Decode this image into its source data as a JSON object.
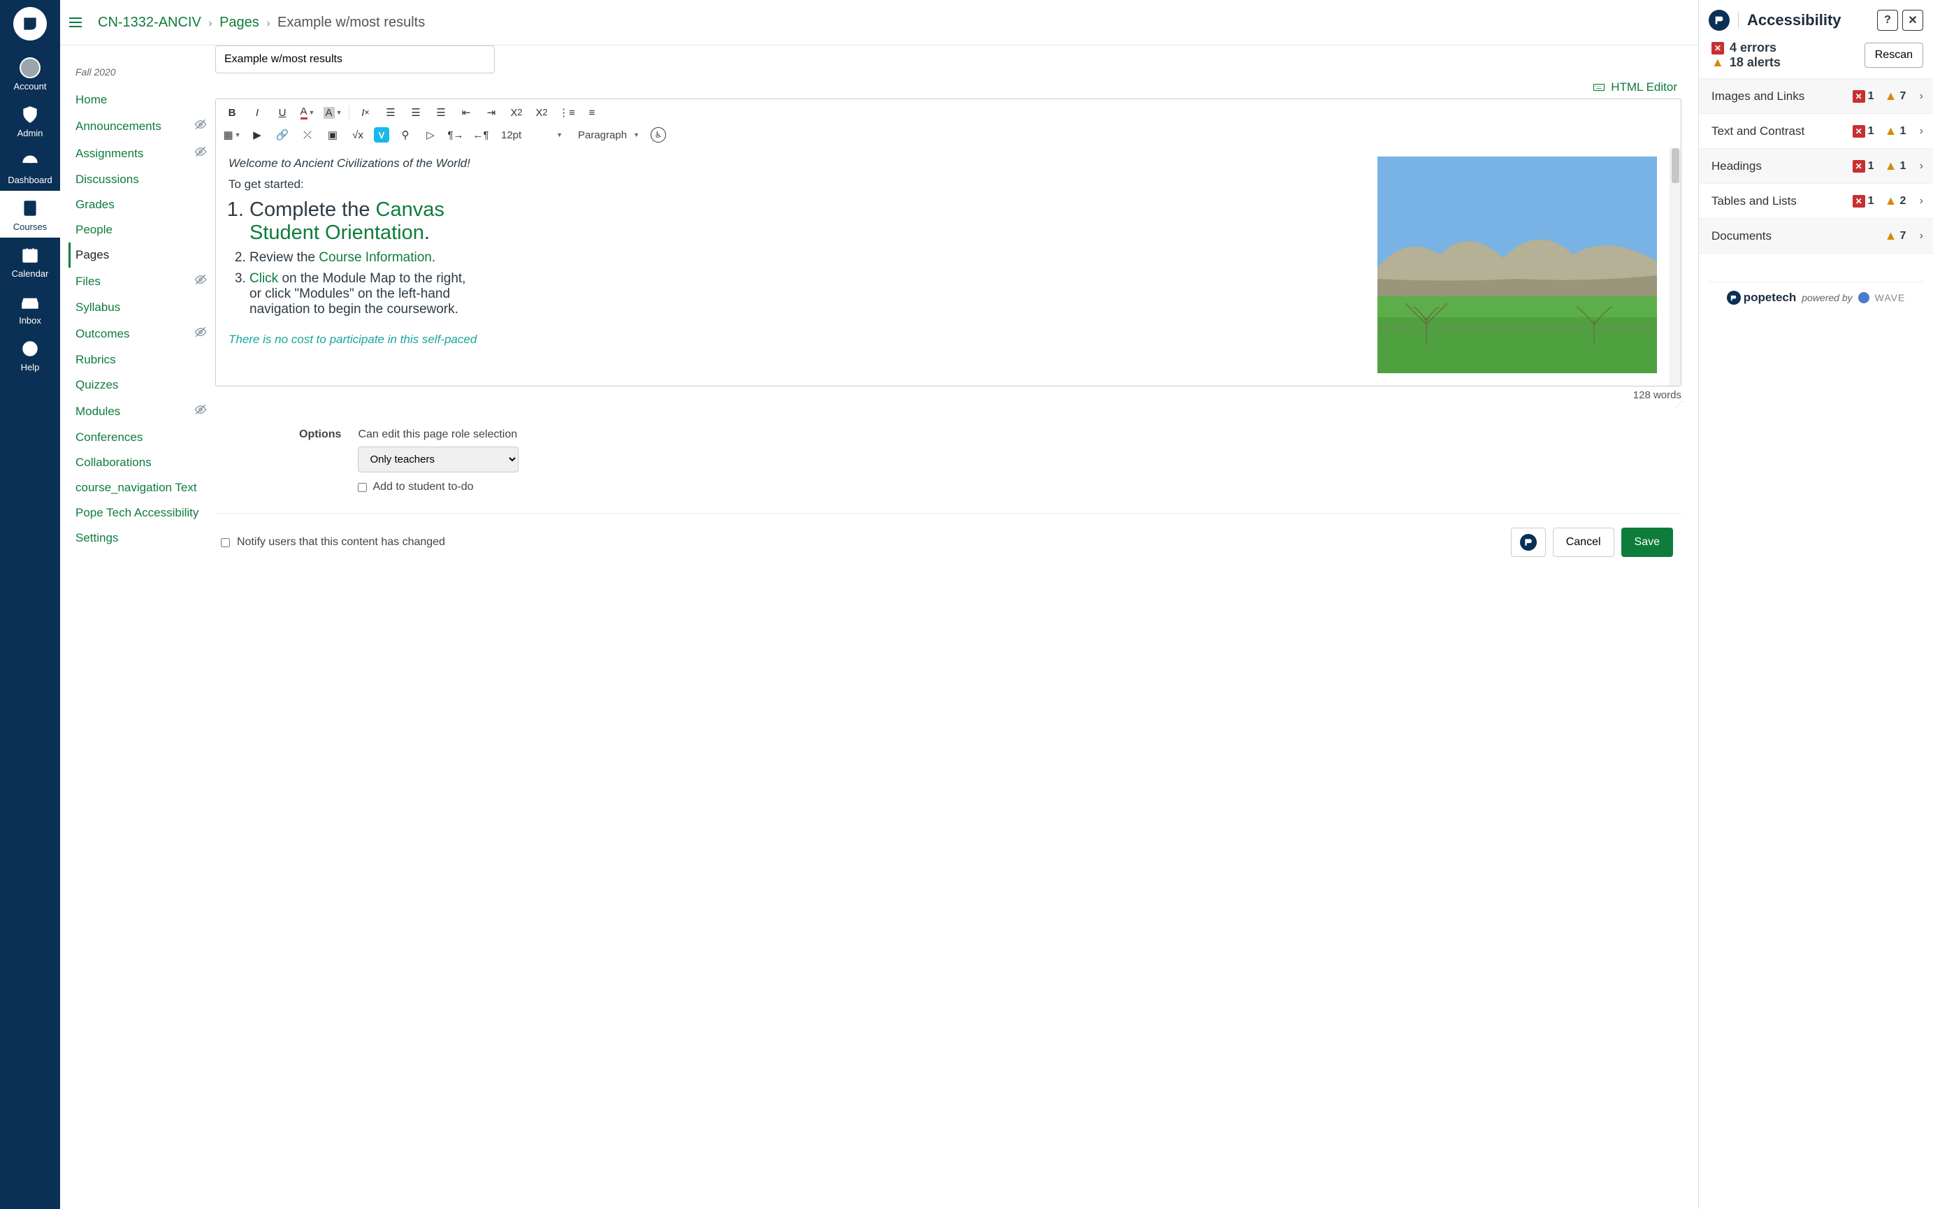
{
  "global_nav": {
    "items": [
      {
        "id": "account",
        "label": "Account"
      },
      {
        "id": "admin",
        "label": "Admin"
      },
      {
        "id": "dashboard",
        "label": "Dashboard"
      },
      {
        "id": "courses",
        "label": "Courses"
      },
      {
        "id": "calendar",
        "label": "Calendar"
      },
      {
        "id": "inbox",
        "label": "Inbox"
      },
      {
        "id": "help",
        "label": "Help"
      }
    ],
    "active": "courses"
  },
  "course": {
    "term": "Fall 2020",
    "nav": [
      {
        "label": "Home",
        "hidden": false
      },
      {
        "label": "Announcements",
        "hidden": true
      },
      {
        "label": "Assignments",
        "hidden": true
      },
      {
        "label": "Discussions",
        "hidden": false
      },
      {
        "label": "Grades",
        "hidden": false
      },
      {
        "label": "People",
        "hidden": false
      },
      {
        "label": "Pages",
        "hidden": false,
        "active": true
      },
      {
        "label": "Files",
        "hidden": true
      },
      {
        "label": "Syllabus",
        "hidden": false
      },
      {
        "label": "Outcomes",
        "hidden": true
      },
      {
        "label": "Rubrics",
        "hidden": false
      },
      {
        "label": "Quizzes",
        "hidden": false
      },
      {
        "label": "Modules",
        "hidden": true
      },
      {
        "label": "Conferences",
        "hidden": false
      },
      {
        "label": "Collaborations",
        "hidden": false
      },
      {
        "label": "course_navigation Text",
        "hidden": false
      },
      {
        "label": "Pope Tech Accessibility",
        "hidden": false
      },
      {
        "label": "Settings",
        "hidden": false
      }
    ]
  },
  "breadcrumb": {
    "course": "CN-1332-ANCIV",
    "section": "Pages",
    "page": "Example w/most results"
  },
  "editor": {
    "title": "Example w/most results",
    "html_editor_link": "HTML Editor",
    "font_size": "12pt",
    "block_format": "Paragraph",
    "content": {
      "welcome": "Welcome to Ancient Civilizations of the World!",
      "get_started": "To get started:",
      "steps": [
        {
          "prefix": "Complete the ",
          "link": "Canvas Student Orientation",
          "suffix": "."
        },
        {
          "prefix": "Review the ",
          "link": "Course Information",
          "suffix": "."
        },
        {
          "prefix_link": "Click",
          "prefix": " on the Module Map to the right, or click \"Modules\" on the left-hand navigation to begin the coursework."
        }
      ],
      "note": "There is no cost to participate in this self-paced"
    },
    "word_count": "128 words"
  },
  "options": {
    "label": "Options",
    "edit_role_label": "Can edit this page role selection",
    "edit_role_value": "Only teachers",
    "add_todo_label": "Add to student to-do"
  },
  "footer": {
    "notify_label": "Notify users that this content has changed",
    "cancel": "Cancel",
    "save": "Save"
  },
  "a11y": {
    "title": "Accessibility",
    "errors_count": "4 errors",
    "alerts_count": "18 alerts",
    "rescan": "Rescan",
    "categories": [
      {
        "name": "Images and Links",
        "errors": "1",
        "alerts": "7"
      },
      {
        "name": "Text and Contrast",
        "errors": "1",
        "alerts": "1"
      },
      {
        "name": "Headings",
        "errors": "1",
        "alerts": "1"
      },
      {
        "name": "Tables and Lists",
        "errors": "1",
        "alerts": "2"
      },
      {
        "name": "Documents",
        "errors": "",
        "alerts": "7"
      }
    ],
    "brand": "popetech",
    "powered": "powered by",
    "wave": "WAVE"
  }
}
